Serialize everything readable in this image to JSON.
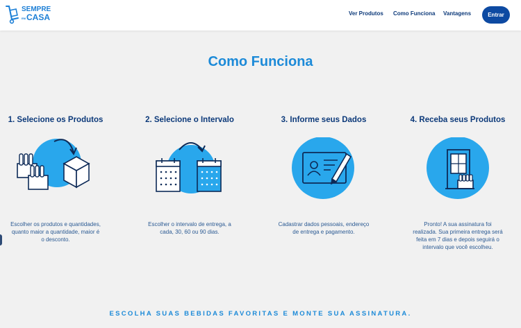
{
  "brand": {
    "line1": "SEMPRE",
    "line2_small": "EM",
    "line2": "CASA",
    "color": "#1c7fd6"
  },
  "nav": {
    "items": [
      "Ver Produtos",
      "Como Funciona",
      "Vantagens"
    ],
    "login_label": "Entrar"
  },
  "main": {
    "title": "Como Funciona",
    "steps": [
      {
        "title": "1. Selecione os Produtos",
        "icon": "products-box-icon",
        "desc": [
          "Escolher os produtos e quantidades,",
          "quanto maior a quantidade, maior é",
          "o desconto."
        ]
      },
      {
        "title": "2. Selecione o Intervalo",
        "icon": "calendar-interval-icon",
        "desc": [
          "Escolher o intervalo de entrega, a",
          "cada, 30, 60 ou 90 dias."
        ]
      },
      {
        "title": "3. Informe seus Dados",
        "icon": "id-card-icon",
        "desc": [
          "Cadastrar dados pessoais, endereço",
          "de entrega e pagamento."
        ]
      },
      {
        "title": "4. Receba seus Produtos",
        "icon": "door-delivery-icon",
        "desc": [
          "Pronto! A sua assinatura foi",
          "realizada. Sua primeira entrega será",
          "feita em 7 dias e depois seguirá o",
          "intervalo que você escolheu."
        ]
      }
    ]
  },
  "footer": {
    "cta": "ESCOLHA SUAS BEBIDAS FAVORITAS E MONTE SUA ASSINATURA."
  },
  "colors": {
    "accent": "#1c8ad8",
    "circle": "#29a7ec",
    "navy": "#0d3a7a",
    "button": "#0d4aa2"
  }
}
